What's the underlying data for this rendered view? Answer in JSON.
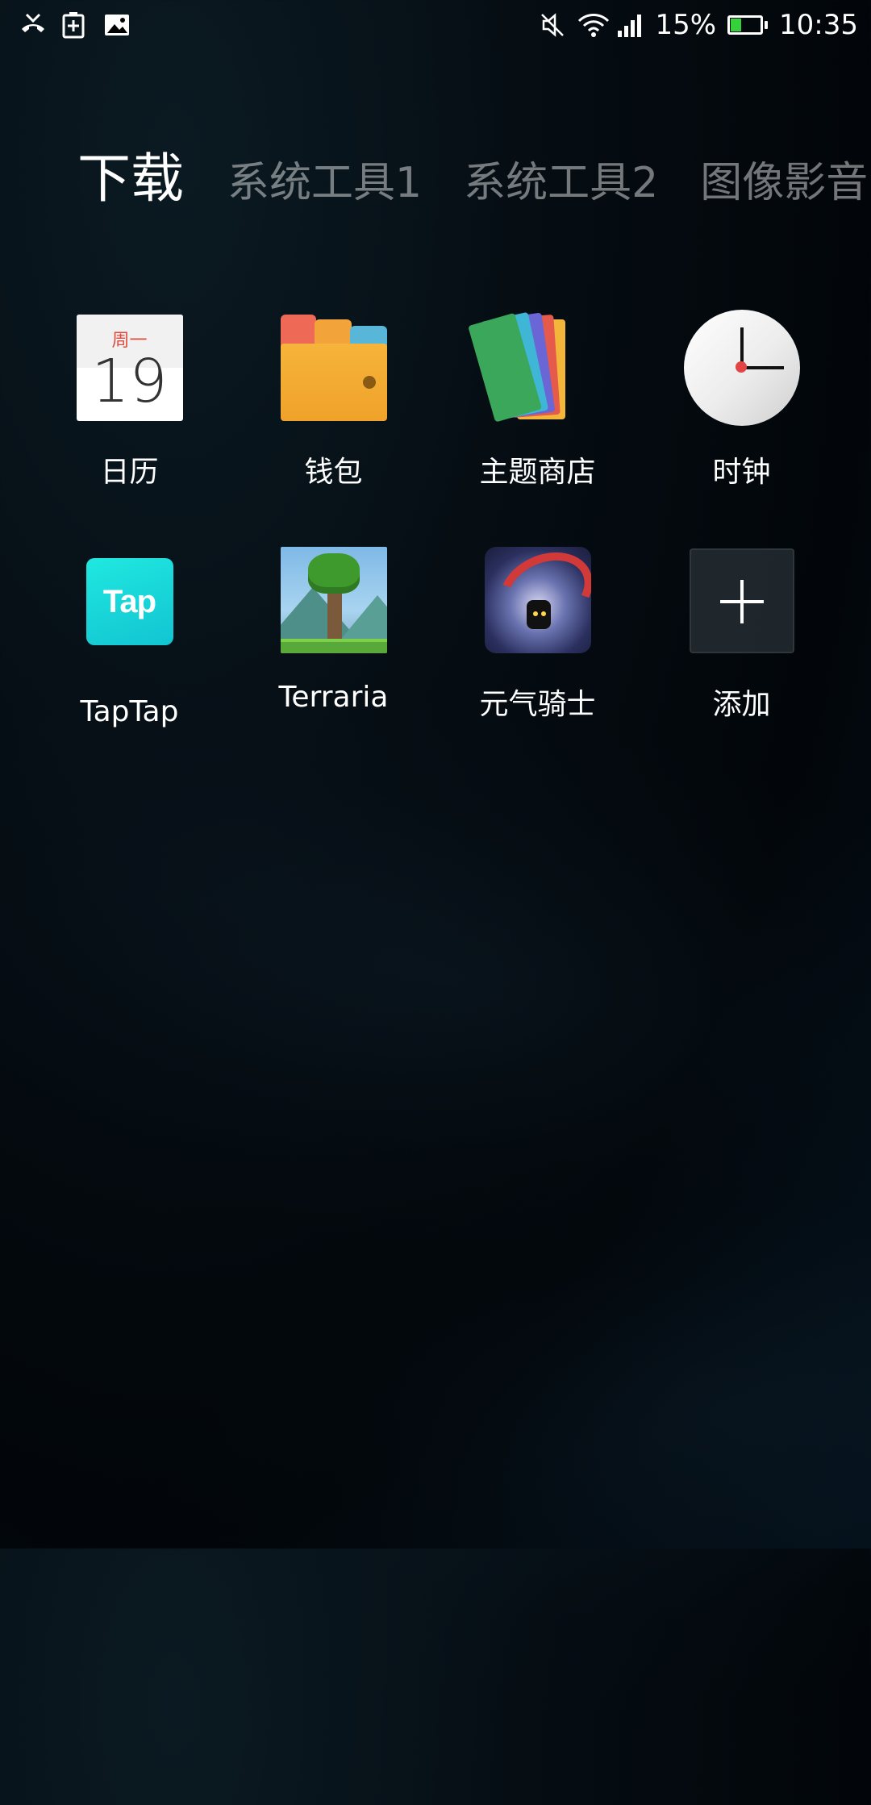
{
  "status_bar": {
    "left_icons": [
      "missed-call-icon",
      "battery-saver-icon",
      "gallery-icon"
    ],
    "right_icons": [
      "mute-icon",
      "wifi-icon",
      "signal-icon"
    ],
    "battery_percent": "15%",
    "battery_level": 0.15,
    "battery_color": "#35d13a",
    "time": "10:35"
  },
  "tabs": [
    {
      "label": "下载",
      "active": true
    },
    {
      "label": "系统工具1",
      "active": false
    },
    {
      "label": "系统工具2",
      "active": false
    },
    {
      "label": "图像影音",
      "active": false
    }
  ],
  "apps": [
    {
      "label": "日历",
      "icon": "calendar-icon",
      "calendar_week": "周一",
      "calendar_day": "19"
    },
    {
      "label": "钱包",
      "icon": "wallet-icon"
    },
    {
      "label": "主题商店",
      "icon": "theme-store-icon"
    },
    {
      "label": "时钟",
      "icon": "clock-icon"
    },
    {
      "label": "TapTap",
      "icon": "taptap-icon",
      "icon_text": "Tap"
    },
    {
      "label": "Terraria",
      "icon": "terraria-icon"
    },
    {
      "label": "元气骑士",
      "icon": "soul-knight-icon"
    },
    {
      "label": "添加",
      "icon": "add-icon"
    }
  ]
}
